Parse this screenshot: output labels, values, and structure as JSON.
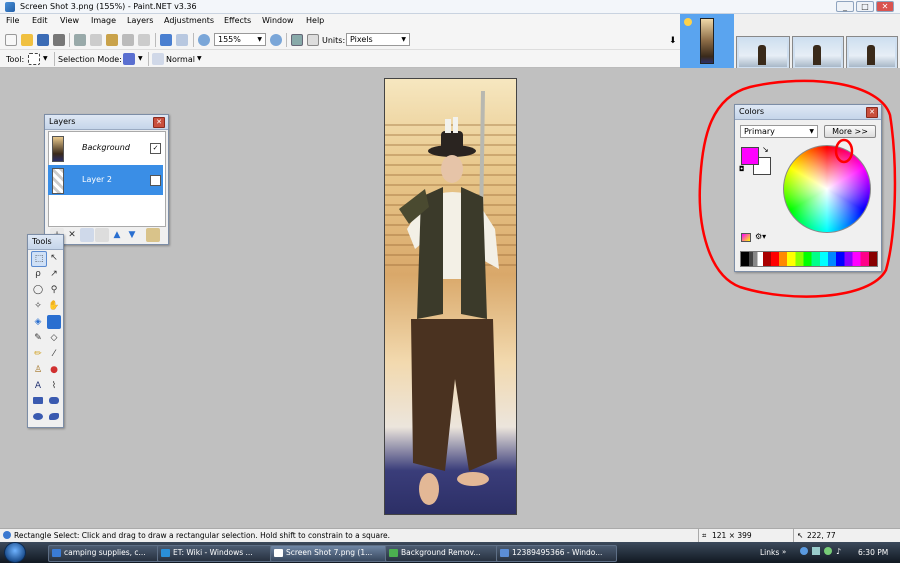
{
  "window": {
    "title": "Screen Shot 3.png (155%) - Paint.NET v3.36",
    "minimize": "_",
    "maximize": "□",
    "close": "✕"
  },
  "menu": [
    "File",
    "Edit",
    "View",
    "Image",
    "Layers",
    "Adjustments",
    "Effects",
    "Window",
    "Help"
  ],
  "toolbar": {
    "zoom_value": "155%",
    "units_label": "Units:",
    "units_value": "Pixels"
  },
  "toolbar2": {
    "tool_label": "Tool:",
    "selection_mode_label": "Selection Mode:",
    "blend_mode": "Normal"
  },
  "layers_panel": {
    "title": "Layers",
    "layers": [
      {
        "name": "Background",
        "visible": "✓",
        "selected": false
      },
      {
        "name": "Layer 2",
        "visible": "✓",
        "selected": true
      }
    ]
  },
  "tools_panel": {
    "title": "Tools"
  },
  "colors_panel": {
    "title": "Colors",
    "mode_value": "Primary",
    "more_button": "More >>",
    "primary_color": "#ff00ff",
    "secondary_color": "#ffffff"
  },
  "status_bar": {
    "hint": "Rectangle Select: Click and drag to draw a rectangular selection. Hold shift to constrain to a square.",
    "selection_size": "121 × 399",
    "cursor_pos": "222, 77"
  },
  "taskbar": {
    "tasks": [
      {
        "label": "camping supplies, c...",
        "active": false,
        "color": "#3a7bd5"
      },
      {
        "label": "ET: Wiki - Windows ...",
        "active": false,
        "color": "#2a8fd8"
      },
      {
        "label": "Screen Shot 7.png (1...",
        "active": true,
        "color": "#ffffff"
      },
      {
        "label": "Background Remov...",
        "active": false,
        "color": "#4caf50"
      },
      {
        "label": "12389495366 - Windo...",
        "active": false,
        "color": "#5b8dd6"
      }
    ],
    "links_label": "Links",
    "clock": "6:30 PM"
  },
  "annotation_color": "#ff0000"
}
